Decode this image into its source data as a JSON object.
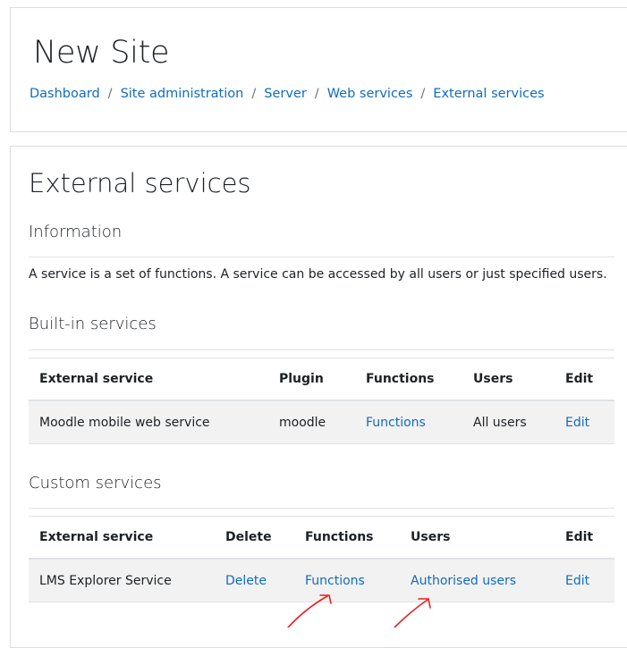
{
  "header": {
    "site_title": "New Site",
    "breadcrumb": [
      "Dashboard",
      "Site administration",
      "Server",
      "Web services",
      "External services"
    ],
    "separator": "/"
  },
  "main": {
    "heading": "External services",
    "information": {
      "heading": "Information",
      "text": "A service is a set of functions. A service can be accessed by all users or just specified users."
    },
    "builtin": {
      "heading": "Built-in services",
      "columns": [
        "External service",
        "Plugin",
        "Functions",
        "Users",
        "Edit"
      ],
      "rows": [
        {
          "service": "Moodle mobile web service",
          "plugin": "moodle",
          "functions": "Functions",
          "users": "All users",
          "edit": "Edit"
        }
      ]
    },
    "custom": {
      "heading": "Custom services",
      "columns": [
        "External service",
        "Delete",
        "Functions",
        "Users",
        "Edit"
      ],
      "rows": [
        {
          "service": "LMS Explorer Service",
          "delete": "Delete",
          "functions": "Functions",
          "users": "Authorised users",
          "edit": "Edit"
        }
      ]
    }
  },
  "colors": {
    "link": "#0f6cbf",
    "annotation_arrow": "#e8201c"
  }
}
